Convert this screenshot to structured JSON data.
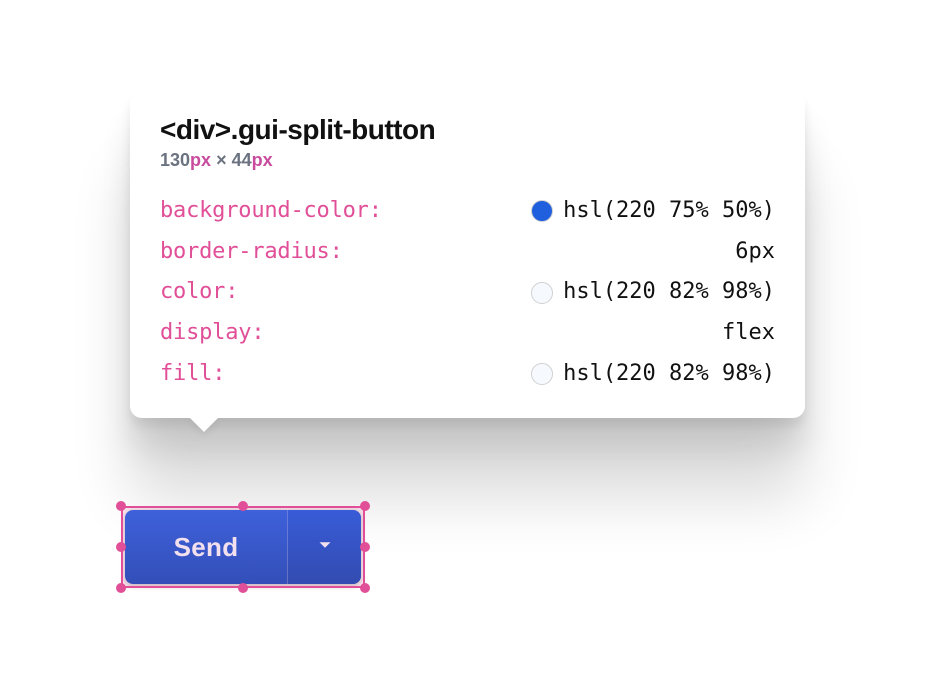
{
  "tooltip": {
    "selector_tag": "<div>",
    "selector_class": ".gui-split-button",
    "dim_w_num": "130",
    "dim_w_unit": "px",
    "dim_sep": " × ",
    "dim_h_num": "44",
    "dim_h_unit": "px",
    "properties": [
      {
        "name": "background-color",
        "swatch": "hsl(220 75% 50%)",
        "value": "hsl(220 75% 50%)"
      },
      {
        "name": "border-radius",
        "swatch": null,
        "value": "6px"
      },
      {
        "name": "color",
        "swatch": "hsl(220 82% 98%)",
        "value": "hsl(220 82% 98%)"
      },
      {
        "name": "display",
        "swatch": null,
        "value": "flex"
      },
      {
        "name": "fill",
        "swatch": "hsl(220 82% 98%)",
        "value": "hsl(220 82% 98%)"
      }
    ]
  },
  "button": {
    "label": "Send"
  }
}
